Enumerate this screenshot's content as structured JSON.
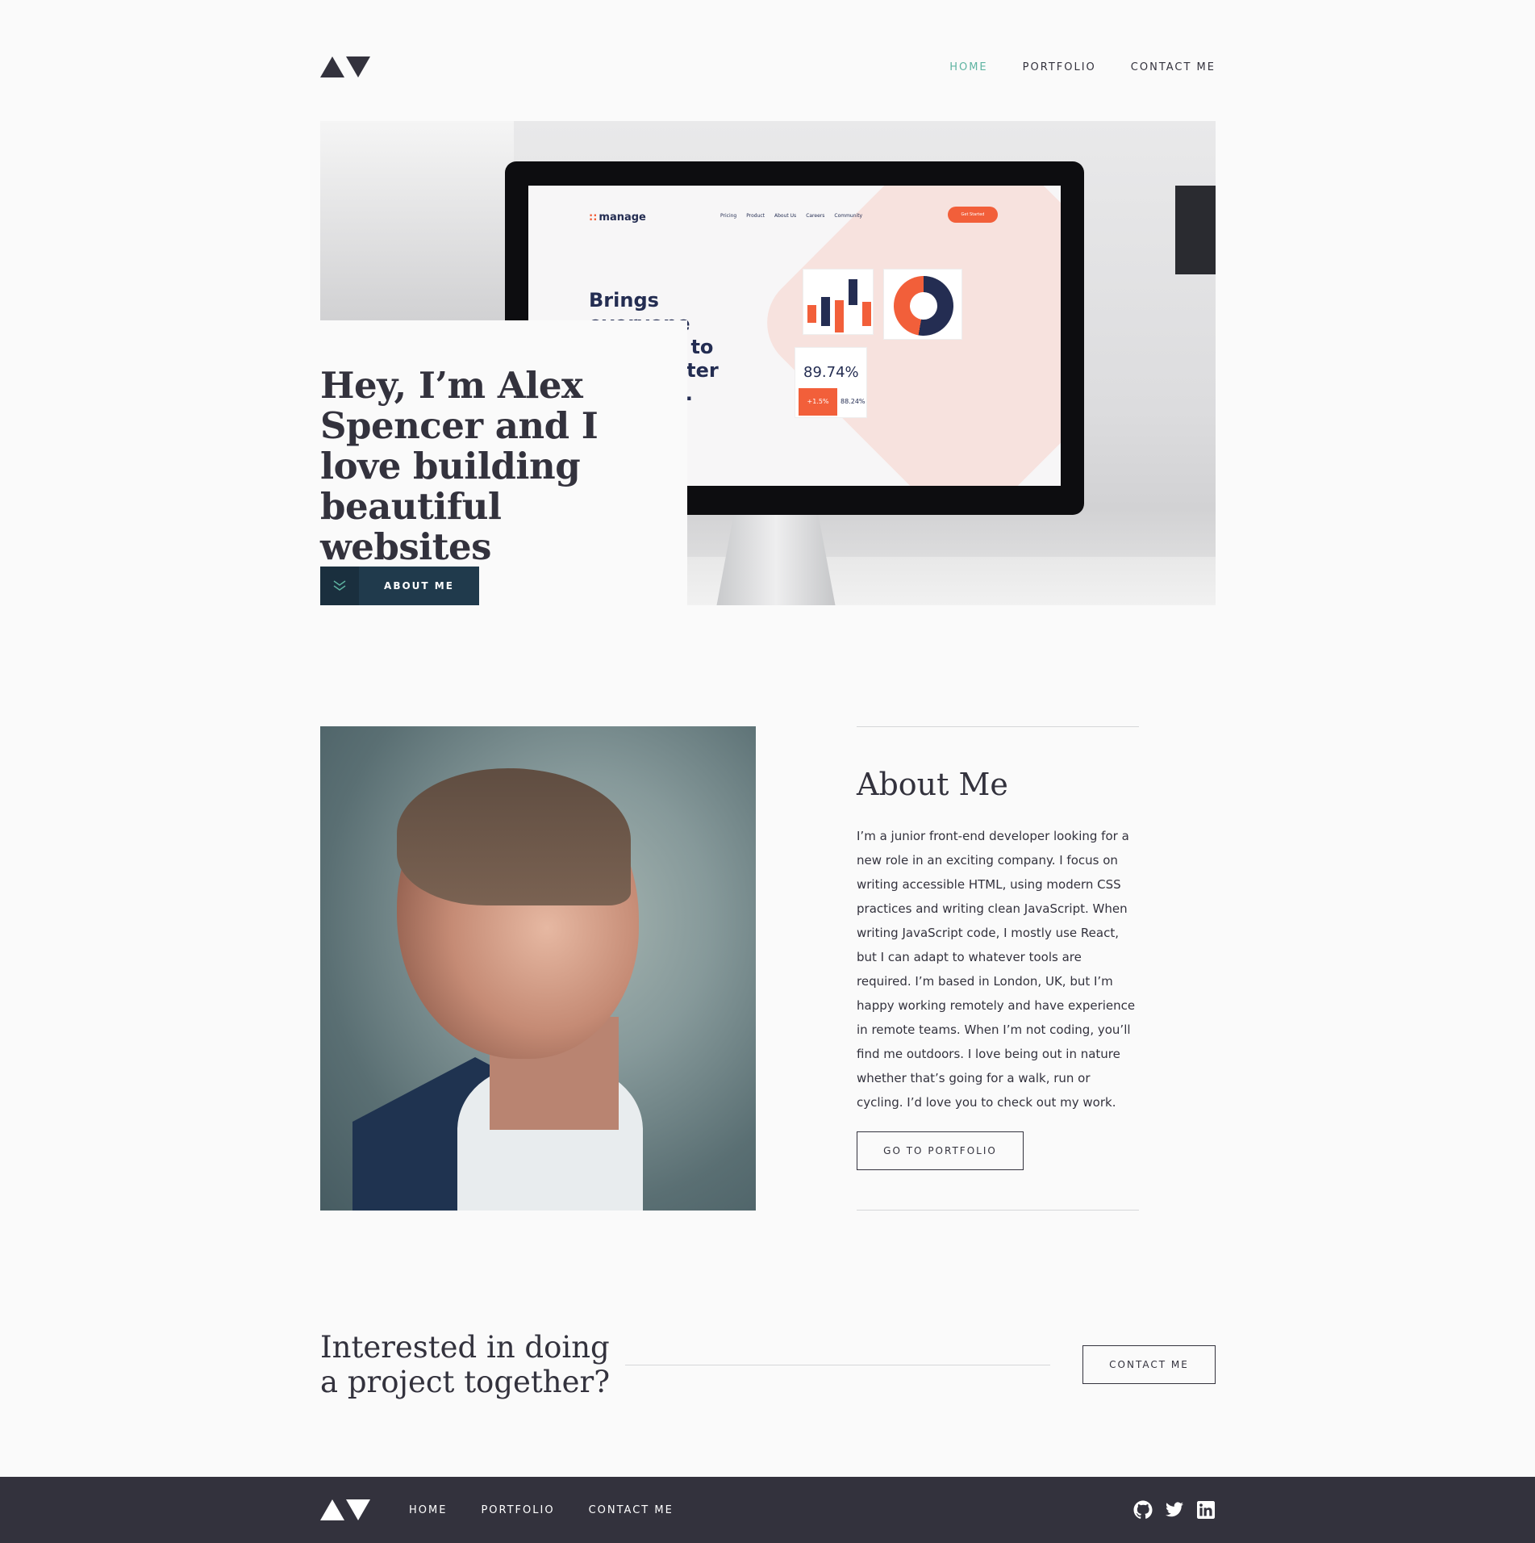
{
  "nav": {
    "home": "HOME",
    "portfolio": "PORTFOLIO",
    "contact": "CONTACT ME"
  },
  "colors": {
    "accent": "#5fb4a2",
    "dark": "#33323d",
    "button": "#203a4c",
    "background": "#fafafa"
  },
  "hero": {
    "title": "Hey, I’m Alex Spencer and I love building beautiful websites",
    "button": "ABOUT ME",
    "screen": {
      "logo": "manage",
      "nav": [
        "Pricing",
        "Product",
        "About Us",
        "Careers",
        "Community"
      ],
      "cta": "Get Started",
      "headline": "Brings everyone together to build better products.",
      "stat_main": "89.74%",
      "stat_badge": "+1.5%",
      "stat_small": "88.24%"
    }
  },
  "about": {
    "title": "About Me",
    "body": "I’m a junior front-end developer looking for a new role in an exciting company. I focus on writing accessible HTML, using modern CSS practices and writing clean JavaScript. When writing JavaScript code, I mostly use React, but I can adapt to whatever tools are required. I’m based in London, UK, but I’m happy working remotely and have experience in remote teams. When I’m not coding, you’ll find me outdoors. I love being out in nature whether that’s going for a walk, run or cycling. I’d love you to check out my work.",
    "button": "GO TO PORTFOLIO"
  },
  "cta": {
    "title": "Interested in doing a project together?",
    "button": "CONTACT ME"
  },
  "footer": {
    "nav": [
      "HOME",
      "PORTFOLIO",
      "CONTACT ME"
    ],
    "social": [
      "github-icon",
      "twitter-icon",
      "linkedin-icon"
    ]
  }
}
